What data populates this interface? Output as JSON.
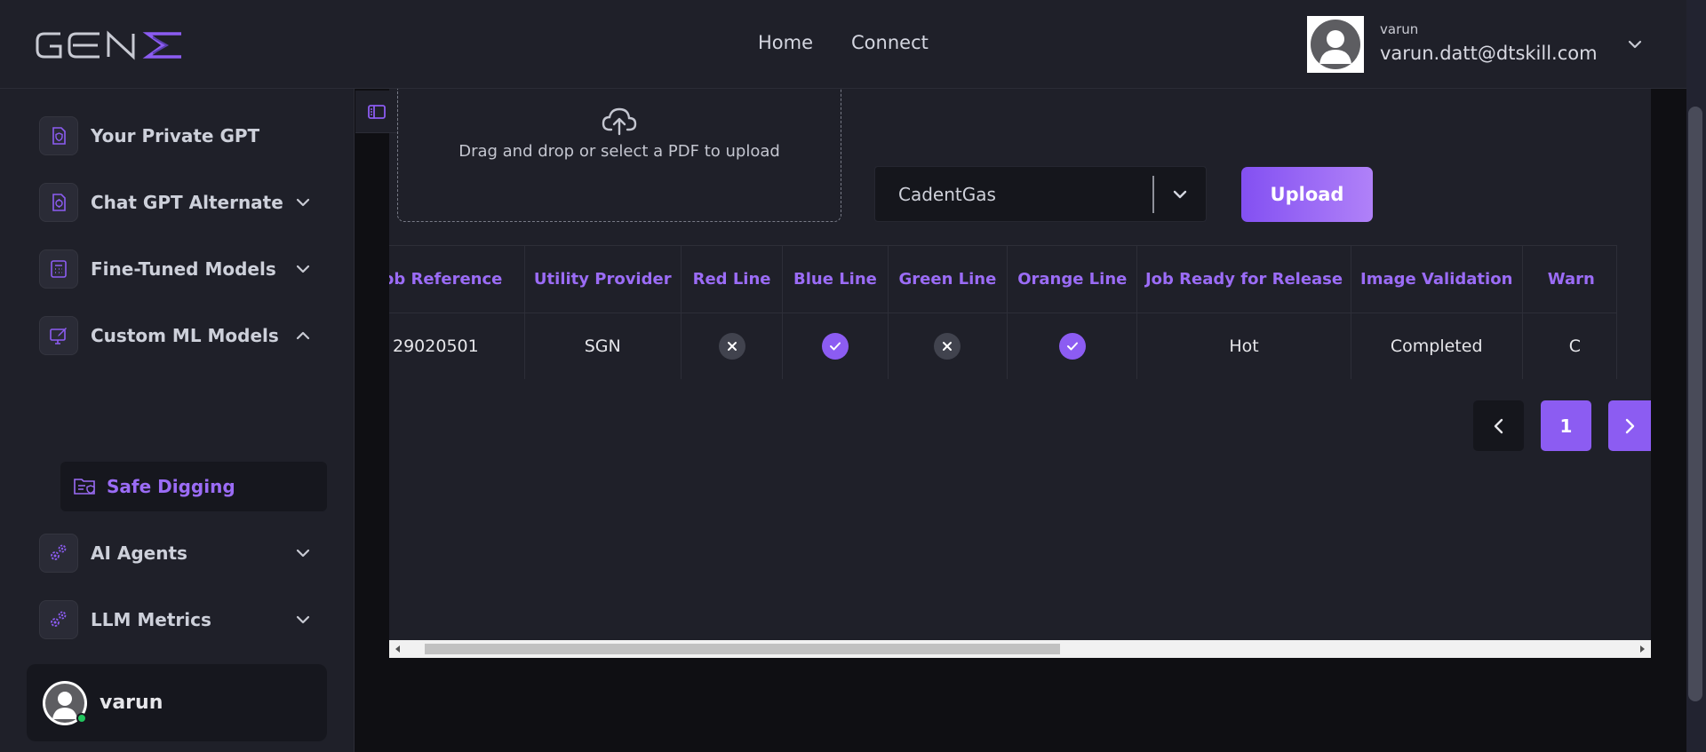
{
  "header": {
    "logo_text": "GENE",
    "nav": [
      {
        "label": "Home"
      },
      {
        "label": "Connect"
      }
    ],
    "user": {
      "name": "varun",
      "email": "varun.datt@dtskill.com"
    }
  },
  "sidebar": {
    "items": [
      {
        "label": "Your Private GPT",
        "icon": "shield-doc-icon",
        "expandable": false
      },
      {
        "label": "Chat GPT Alternate",
        "icon": "chat-doc-icon",
        "expandable": true,
        "expanded": false
      },
      {
        "label": "Fine-Tuned Models",
        "icon": "calculator-icon",
        "expandable": true,
        "expanded": false
      },
      {
        "label": "Custom ML Models",
        "icon": "edit-monitor-icon",
        "expandable": true,
        "expanded": true
      },
      {
        "label": "AI Agents",
        "icon": "gears-icon",
        "expandable": true,
        "expanded": false
      },
      {
        "label": "LLM Metrics",
        "icon": "gears-icon",
        "expandable": true,
        "expanded": false
      }
    ],
    "active_sub_item": {
      "label": "Safe Digging",
      "icon": "folder-shield-icon"
    },
    "profile": {
      "name": "varun",
      "status": "online"
    }
  },
  "upload": {
    "dropzone_text": "Drag and drop or select a PDF to upload",
    "provider_select": {
      "value": "CadentGas"
    },
    "button_label": "Upload"
  },
  "table": {
    "columns": [
      "Job Reference",
      "Utility Provider",
      "Red Line",
      "Blue Line",
      "Green Line",
      "Orange Line",
      "Job Ready for Release",
      "Image Validation",
      "Warn"
    ],
    "rows": [
      {
        "job_reference": "29020501",
        "utility_provider": "SGN",
        "red_line": false,
        "blue_line": true,
        "green_line": false,
        "orange_line": true,
        "job_ready_for_release": "Hot",
        "image_validation": "Completed",
        "warn": "C"
      }
    ]
  },
  "pagination": {
    "current_page": "1"
  },
  "colors": {
    "accent": "#8c5cf2",
    "header_text_purple": "#9b6cf6",
    "panel_bg": "#1f2029",
    "page_bg": "#0f0f13"
  }
}
